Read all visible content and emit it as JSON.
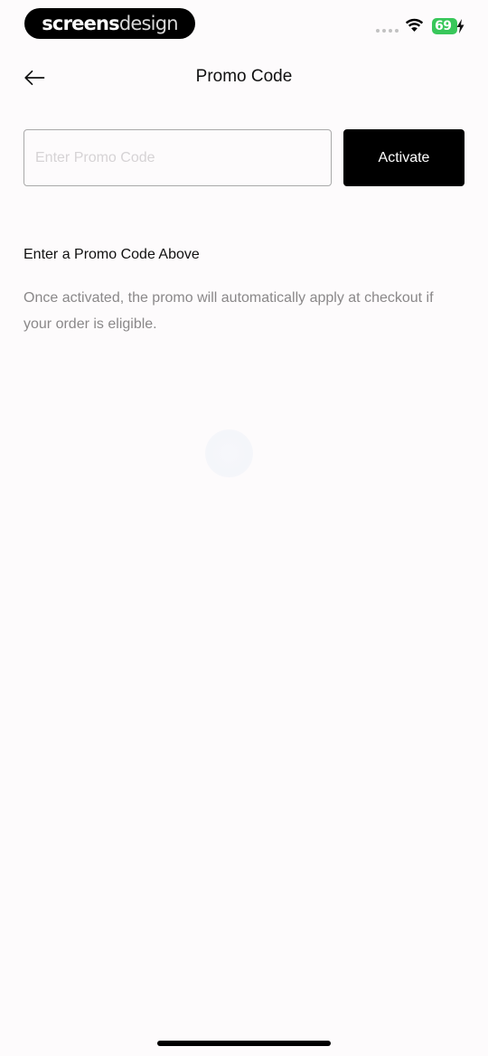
{
  "status_bar": {
    "brand": {
      "part1": "screens",
      "part2": "design"
    },
    "battery_level": "69",
    "icons": [
      "signal-dots-icon",
      "wifi-icon",
      "battery-icon",
      "charging-bolt-icon"
    ],
    "battery_color": "#38c75a"
  },
  "header": {
    "title": "Promo Code",
    "back_icon": "arrow-left-icon"
  },
  "promo": {
    "placeholder": "Enter Promo Code",
    "value": "",
    "activate_label": "Activate"
  },
  "info": {
    "heading": "Enter a Promo Code Above",
    "body": "Once activated, the promo will automatically apply at checkout if your order is eligible."
  },
  "colors": {
    "background": "#fdfbfc",
    "primary": "#000000",
    "muted_text": "#8a8889",
    "placeholder": "#d6d3d5"
  }
}
